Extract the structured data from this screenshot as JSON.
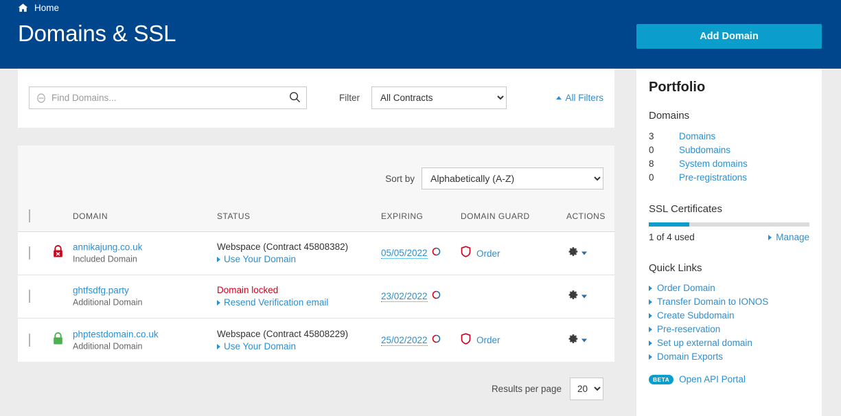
{
  "header": {
    "breadcrumb": "Home",
    "home_icon": "home-icon",
    "title": "Domains & SSL",
    "add_domain_label": "Add Domain",
    "bg_color": "#00468c",
    "accent_color": "#0b9dcc"
  },
  "filters": {
    "search_placeholder": "Find Domains...",
    "search_value": "",
    "search_icon": "magnifier-icon",
    "filter_label": "Filter",
    "filter_value": "All Contracts",
    "all_filters_label": "All Filters"
  },
  "table": {
    "sort_label": "Sort by",
    "sort_value": "Alphabetically (A-Z)",
    "columns": [
      "DOMAIN",
      "STATUS",
      "EXPIRING",
      "DOMAIN GUARD",
      "ACTIONS"
    ],
    "rows": [
      {
        "lock": "locked-red",
        "domain": "annikajung.co.uk",
        "type": "Included Domain",
        "status": "Webspace (Contract 45808382)",
        "status_locked": false,
        "status_link": "Use Your Domain",
        "expiring": "05/05/2022",
        "guard": "Order",
        "has_guard": true
      },
      {
        "lock": "none",
        "domain": "ghtfsdfg.party",
        "type": "Additional Domain",
        "status": "Domain locked",
        "status_locked": true,
        "status_link": "Resend Verification email",
        "expiring": "23/02/2022",
        "guard": "",
        "has_guard": false
      },
      {
        "lock": "unlocked-green",
        "domain": "phptestdomain.co.uk",
        "type": "Additional Domain",
        "status": "Webspace (Contract 45808229)",
        "status_locked": false,
        "status_link": "Use Your Domain",
        "expiring": "25/02/2022",
        "guard": "Order",
        "has_guard": true
      }
    ]
  },
  "footer": {
    "results_per_page_label": "Results per page",
    "results_per_page_value": "20"
  },
  "sidebar": {
    "title": "Portfolio",
    "domains_heading": "Domains",
    "stats": [
      {
        "count": "3",
        "label": "Domains"
      },
      {
        "count": "0",
        "label": "Subdomains"
      },
      {
        "count": "8",
        "label": "System domains"
      },
      {
        "count": "0",
        "label": "Pre-registrations"
      }
    ],
    "ssl_heading": "SSL Certificates",
    "ssl_used_text": "1 of 4 used",
    "ssl_progress_percent": 25,
    "ssl_manage_label": "Manage",
    "quick_links_heading": "Quick Links",
    "quick_links": [
      "Order Domain",
      "Transfer Domain to IONOS",
      "Create Subdomain",
      "Pre-reservation",
      "Set up external domain",
      "Domain Exports"
    ],
    "beta_badge": "BETA",
    "beta_link": "Open API Portal"
  }
}
